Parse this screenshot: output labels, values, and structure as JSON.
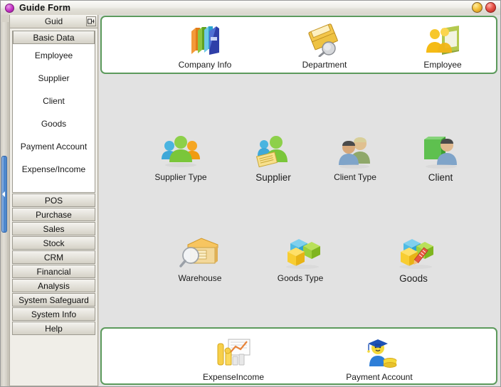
{
  "window": {
    "title": "Guide Form",
    "app_icon": "circle-app-icon",
    "buttons": [
      {
        "name": "minimize-button",
        "icon": "minimize-circle-icon",
        "color": "#f5c23c"
      },
      {
        "name": "close-button",
        "icon": "close-circle-icon",
        "color": "#e8544a"
      }
    ]
  },
  "sidebar": {
    "header_title": "Guid",
    "pin_icon": "pin-dock-icon",
    "active_group": "Basic Data",
    "items": [
      {
        "label": "Employee"
      },
      {
        "label": "Supplier"
      },
      {
        "label": "Client"
      },
      {
        "label": "Goods"
      },
      {
        "label": "Payment Account"
      },
      {
        "label": "Expense/Income"
      }
    ],
    "groups": [
      {
        "label": "POS"
      },
      {
        "label": "Purchase"
      },
      {
        "label": "Sales"
      },
      {
        "label": "Stock"
      },
      {
        "label": "CRM"
      },
      {
        "label": "Financial"
      },
      {
        "label": "Analysis"
      },
      {
        "label": "System Safeguard"
      },
      {
        "label": "System Info"
      },
      {
        "label": "Help"
      }
    ]
  },
  "main": {
    "top_panel": {
      "tiles": [
        {
          "label": "Company Info",
          "icon": "books-stack-icon"
        },
        {
          "label": "Department",
          "icon": "folder-magnifier-icon"
        },
        {
          "label": "Employee",
          "icon": "people-book-icon"
        }
      ]
    },
    "middle_panel": {
      "row1": [
        {
          "label": "Supplier Type",
          "icon": "people-group-icon"
        },
        {
          "label": "Supplier",
          "icon": "people-document-icon"
        },
        {
          "label": "Client Type",
          "icon": "two-persons-icon"
        },
        {
          "label": "Client",
          "icon": "person-board-icon"
        }
      ],
      "row2": [
        {
          "label": "Warehouse",
          "icon": "warehouse-magnifier-icon"
        },
        {
          "label": "Goods Type",
          "icon": "boxes-icon"
        },
        {
          "label": "Goods",
          "icon": "boxes-pen-icon"
        }
      ]
    },
    "bottom_panel": {
      "tiles": [
        {
          "label": "ExpenseIncome",
          "icon": "chart-bars-icon"
        },
        {
          "label": "Payment Account",
          "icon": "graduate-coins-icon"
        }
      ]
    }
  },
  "colors": {
    "panel_border_green": "#5c9a5c",
    "work_area_gray": "#e2e2e2",
    "window_chrome": "#d6d2c8",
    "splitter_blue": "#3d7bc6"
  }
}
